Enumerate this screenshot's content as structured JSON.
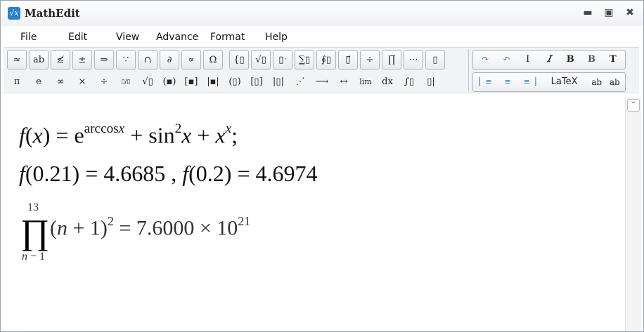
{
  "window": {
    "title": "MathEdit",
    "app_icon": "√x",
    "buttons": {
      "minimize": "▬",
      "maximize": "▣",
      "close": "✖"
    }
  },
  "menu": [
    "File",
    "Edit",
    "View",
    "Advance",
    "Format",
    "Help"
  ],
  "toolbar": {
    "row1": [
      "≈",
      "ab",
      "≰",
      "±",
      "⇒",
      "∵",
      "∩",
      "∂",
      "∝",
      "Ω",
      "{▯",
      "√▯",
      "▯ˑ",
      "∑▯",
      "∮▯",
      "▯⃗",
      "÷",
      "∏̅",
      "⋯",
      "▯"
    ],
    "row2": [
      "π",
      "e",
      "∞",
      "×",
      "÷",
      "▯/▯",
      "√▯",
      "(▪)",
      "[▪]",
      "|▪|",
      "(▯)",
      "[▯]",
      "|▯|",
      "⋰",
      "⟶",
      "↔",
      "lim",
      "dx",
      "∫▯",
      "▯|"
    ],
    "format_row1": [
      "↷",
      "↶",
      "I",
      "𝐼",
      "B",
      "B",
      "T"
    ],
    "format_row2": [
      "▏≡",
      "≡",
      "≡▕",
      "LaTeX",
      "ab",
      "ab"
    ]
  },
  "content": {
    "eq1": {
      "f": "f",
      "open": "(",
      "x": "x",
      "close": ")",
      "eq": " = e",
      "exp": "arccos",
      "expvar": "x",
      "plus": " + sin",
      "sq": "2",
      "x2": "x",
      "plus2": " + ",
      "x3": "x",
      "xexp": "x",
      "semi": ";"
    },
    "eq2": {
      "f": "f",
      "a": "(0.21) = 4.6685 , ",
      "f2": "f",
      "b": "(0.2) = 4.6974"
    },
    "eq3": {
      "upper": "13",
      "lower_n": "n",
      "lower_rest": " − 1",
      "pi": "∏",
      "open": "(",
      "n": "n",
      "mid": " + 1)",
      "pow": "2",
      "eq": " = 7.6000 × 10",
      "exp": "21"
    }
  },
  "scrollbar": {
    "up_arrow": "⌃"
  }
}
